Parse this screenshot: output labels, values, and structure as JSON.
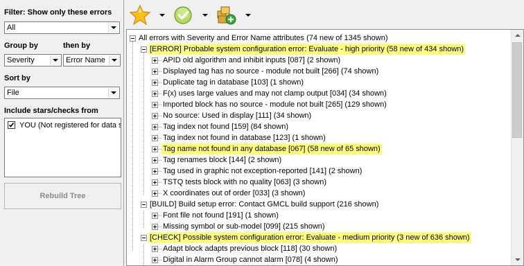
{
  "filter": {
    "label": "Filter: Show only these errors",
    "value": "All"
  },
  "group_by": {
    "label": "Group by",
    "value": "Severity"
  },
  "then_by": {
    "label": "then by",
    "value": "Error Name"
  },
  "sort_by": {
    "label": "Sort by",
    "value": "File"
  },
  "stars": {
    "label": "Include stars/checks from",
    "items": [
      {
        "text": "YOU (Not registered for data sha",
        "checked": true
      }
    ]
  },
  "rebuild_button": "Rebuild Tree",
  "toolbar": {
    "icons": [
      "star-icon",
      "check-circle-icon",
      "package-add-icon"
    ]
  },
  "tree": {
    "root": "All errors with Severity and Error Name attributes (74 new of 1345 shown)",
    "groups": [
      {
        "label": "[ERROR] Probable system configuration error: Evaluate - high priority (58 new of 434 shown)",
        "highlight": true,
        "children": [
          {
            "label": "APID old algorithm and inhibit inputs [087] (2 shown)"
          },
          {
            "label": "Displayed tag has no source - module not built [266] (74 shown)"
          },
          {
            "label": "Duplicate tag in database [103] (1 shown)"
          },
          {
            "label": "F(x) uses large values and may not clamp output [034] (34 shown)"
          },
          {
            "label": "Imported block has no source - module not built [265] (129 shown)"
          },
          {
            "label": "No source: Used in display [111] (34 shown)"
          },
          {
            "label": "Tag index not found [159] (84 shown)"
          },
          {
            "label": "Tag index not found in database [123] (1 shown)"
          },
          {
            "label": "Tag name not found in any database [067] (58 new of 65 shown)",
            "highlight": true
          },
          {
            "label": "Tag renames block [144] (2 shown)"
          },
          {
            "label": "Tag used in graphic not exception-reported [141] (2 shown)"
          },
          {
            "label": "TSTQ tests block with no quality [063] (3 shown)"
          },
          {
            "label": "X coordinates out of order [033] (3 shown)"
          }
        ]
      },
      {
        "label": "[BUILD] Build setup error: Contact GMCL build support (216 shown)",
        "highlight": false,
        "children": [
          {
            "label": "Font file not found [191] (1 shown)"
          },
          {
            "label": "Missing symbol or sub-model [099] (215 shown)"
          }
        ]
      },
      {
        "label": "[CHECK] Possible system configuration error: Evaluate - medium priority (3 new of 636 shown)",
        "highlight": true,
        "children": [
          {
            "label": "Adapt block adapts previous block [118] (30 shown)"
          },
          {
            "label": "Digital in Alarm Group cannot alarm [078] (4 shown)"
          }
        ]
      }
    ]
  }
}
